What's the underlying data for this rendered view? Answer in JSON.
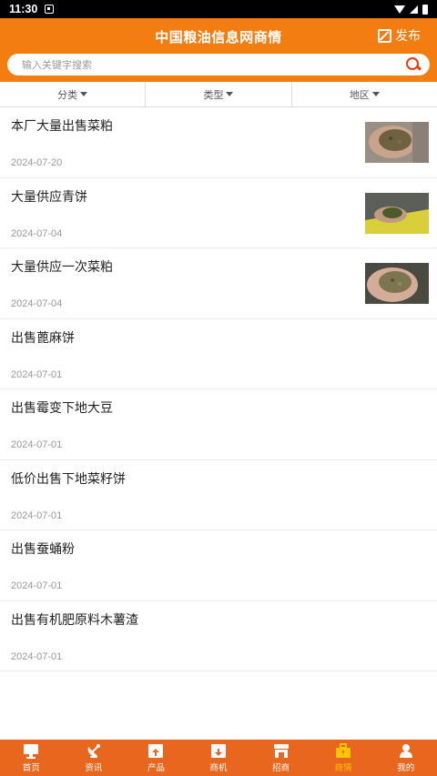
{
  "status_bar": {
    "time": "11:30"
  },
  "header": {
    "title": "中国粮油信息网商情",
    "publish_label": "发布",
    "search_placeholder": "输入关键字搜索"
  },
  "filters": [
    {
      "label": "分类"
    },
    {
      "label": "类型"
    },
    {
      "label": "地区"
    }
  ],
  "listings": [
    {
      "title": "本厂大量出售菜粕",
      "date": "2024-07-20",
      "has_image": true
    },
    {
      "title": "大量供应青饼",
      "date": "2024-07-04",
      "has_image": true
    },
    {
      "title": "大量供应一次菜粕",
      "date": "2024-07-04",
      "has_image": true
    },
    {
      "title": "出售蓖麻饼",
      "date": "2024-07-01",
      "has_image": false
    },
    {
      "title": "出售霉变下地大豆",
      "date": "2024-07-01",
      "has_image": false
    },
    {
      "title": "低价出售下地菜籽饼",
      "date": "2024-07-01",
      "has_image": false
    },
    {
      "title": "出售蚕蛹粉",
      "date": "2024-07-01",
      "has_image": false
    },
    {
      "title": "出售有机肥原料木薯渣",
      "date": "2024-07-01",
      "has_image": false
    }
  ],
  "tabbar": [
    {
      "label": "首页",
      "icon": "monitor-icon",
      "active": false
    },
    {
      "label": "资讯",
      "icon": "satellite-dish-icon",
      "active": false
    },
    {
      "label": "产品",
      "icon": "box-upload-icon",
      "active": false
    },
    {
      "label": "商机",
      "icon": "box-download-icon",
      "active": false
    },
    {
      "label": "招商",
      "icon": "storefront-icon",
      "active": false
    },
    {
      "label": "商情",
      "icon": "briefcase-icon",
      "active": true
    },
    {
      "label": "我的",
      "icon": "user-icon",
      "active": false
    }
  ],
  "colors": {
    "header_orange": "#f47d12",
    "tabbar_orange": "#e8661d",
    "active_tab": "#ffc400",
    "search_icon": "#e33b12"
  }
}
